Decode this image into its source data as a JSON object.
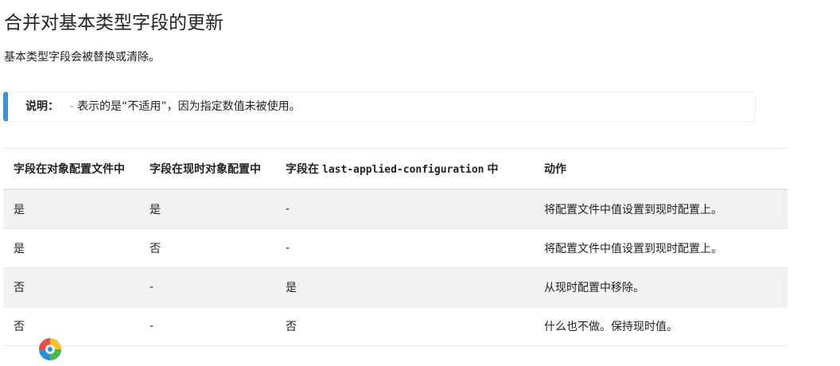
{
  "page": {
    "title": "合并对基本类型字段的更新",
    "subtitle": "基本类型字段会被替换或清除。"
  },
  "note": {
    "label": "说明：",
    "dash": "-",
    "text": "表示的是“不适用”，因为指定数值未被使用。",
    "accent_color": "#3f8ed6"
  },
  "table": {
    "headers": {
      "h1": "字段在对象配置文件中",
      "h2": "字段在现时对象配置中",
      "h3_prefix": "字段在",
      "h3_code": "last-applied-configuration",
      "h3_suffix": "中",
      "h4": "动作"
    },
    "rows": [
      {
        "c1": "是",
        "c2": "是",
        "c3": "-",
        "c4": "将配置文件中值设置到现时配置上。"
      },
      {
        "c1": "是",
        "c2": "否",
        "c3": "-",
        "c4": "将配置文件中值设置到现时配置上。"
      },
      {
        "c1": "否",
        "c2": "-",
        "c3": "是",
        "c4": "从现时配置中移除。"
      },
      {
        "c1": "否",
        "c2": "-",
        "c3": "否",
        "c4": "什么也不做。保持现时值。"
      }
    ]
  },
  "logo": {
    "icon": "colorful-circle-logo"
  }
}
